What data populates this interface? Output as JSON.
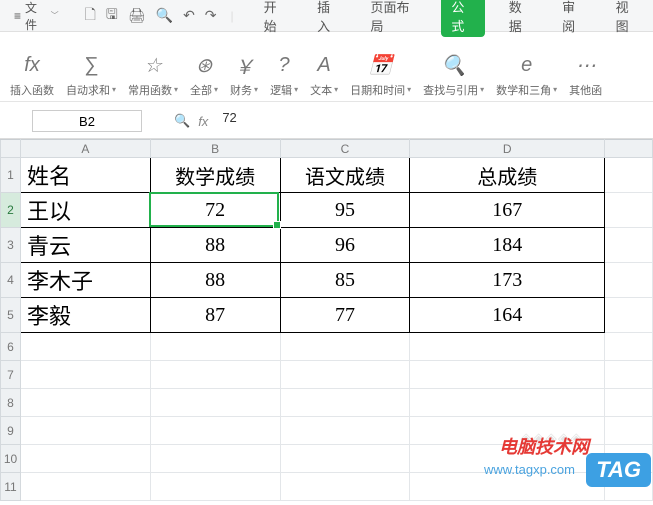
{
  "menu": {
    "file": "文件",
    "tabs": [
      "开始",
      "插入",
      "页面布局",
      "公式",
      "数据",
      "审阅",
      "视图"
    ],
    "active_tab_index": 3
  },
  "ribbon_groups": [
    {
      "icon_name": "fx-icon",
      "icon": "fx",
      "label": "插入函数",
      "caret": false
    },
    {
      "icon_name": "sigma-icon",
      "icon": "∑",
      "label": "自动求和",
      "caret": true
    },
    {
      "icon_name": "star-icon",
      "icon": "☆",
      "label": "常用函数",
      "caret": true
    },
    {
      "icon_name": "asterisk-icon",
      "icon": "⊛",
      "label": "全部",
      "caret": true
    },
    {
      "icon_name": "yen-icon",
      "icon": "￥",
      "label": "财务",
      "caret": true
    },
    {
      "icon_name": "question-icon",
      "icon": "?",
      "label": "逻辑",
      "caret": true
    },
    {
      "icon_name": "text-icon",
      "icon": "A",
      "label": "文本",
      "caret": true
    },
    {
      "icon_name": "calendar-icon",
      "icon": "📅",
      "label": "日期和时间",
      "caret": true
    },
    {
      "icon_name": "search-icon",
      "icon": "🔍",
      "label": "查找与引用",
      "caret": true
    },
    {
      "icon_name": "math-icon",
      "icon": "e",
      "label": "数学和三角",
      "caret": true
    },
    {
      "icon_name": "more-icon",
      "icon": "⋯",
      "label": "其他函",
      "caret": false
    }
  ],
  "namebox": "B2",
  "formula_value": "72",
  "fx_icons": {
    "magnify": "🔍",
    "fx": "fx"
  },
  "headers": [
    "A",
    "B",
    "C",
    "D"
  ],
  "sheet": {
    "row1": {
      "A": "姓名",
      "B": "数学成绩",
      "C": "语文成绩",
      "D": "总成绩"
    },
    "rows": [
      {
        "n": "2",
        "A": "王以",
        "B": "72",
        "C": "95",
        "D": "167"
      },
      {
        "n": "3",
        "A": "青云",
        "B": "88",
        "C": "96",
        "D": "184"
      },
      {
        "n": "4",
        "A": "李木子",
        "B": "88",
        "C": "85",
        "D": "173"
      },
      {
        "n": "5",
        "A": "李毅",
        "B": "87",
        "C": "77",
        "D": "164"
      }
    ]
  },
  "chart_data": {
    "type": "table",
    "title": "",
    "columns": [
      "姓名",
      "数学成绩",
      "语文成绩",
      "总成绩"
    ],
    "rows": [
      [
        "王以",
        72,
        95,
        167
      ],
      [
        "青云",
        88,
        96,
        184
      ],
      [
        "李木子",
        88,
        85,
        173
      ],
      [
        "李毅",
        87,
        77,
        164
      ]
    ]
  },
  "watermark": {
    "line1": "电脑技术网",
    "line2": "www.tagxp.com",
    "badge": "TAG"
  }
}
